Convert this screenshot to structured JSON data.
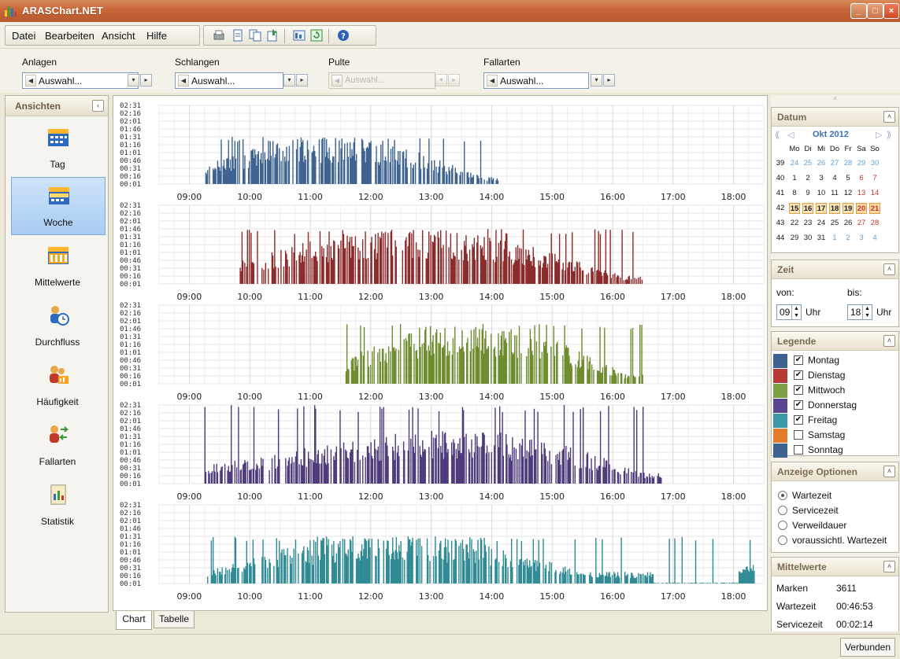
{
  "app": {
    "title": "ARASChart.NET"
  },
  "menu": {
    "items": [
      {
        "label": "Datei"
      },
      {
        "label": "Bearbeiten"
      },
      {
        "label": "Ansicht"
      },
      {
        "label": "Hilfe"
      }
    ]
  },
  "toolbar": {
    "icons": [
      "print-icon",
      "page-icon",
      "copy-icon",
      "export-icon",
      "table-export-icon",
      "refresh-icon",
      "help-icon"
    ]
  },
  "filters": [
    {
      "label": "Anlagen",
      "value": "Auswahl...",
      "disabled": false
    },
    {
      "label": "Schlangen",
      "value": "Auswahl...",
      "disabled": false
    },
    {
      "label": "Pulte",
      "value": "Auswahl...",
      "disabled": true
    },
    {
      "label": "Fallarten",
      "value": "Auswahl...",
      "disabled": false
    }
  ],
  "sidebar": {
    "title": "Ansichten",
    "items": [
      {
        "label": "Tag",
        "icon": "calendar-day-icon",
        "active": false
      },
      {
        "label": "Woche",
        "icon": "calendar-week-icon",
        "active": true
      },
      {
        "label": "Mittelwerte",
        "icon": "calendar-average-icon",
        "active": false
      },
      {
        "label": "Durchfluss",
        "icon": "people-clock-icon",
        "active": false
      },
      {
        "label": "Häufigkeit",
        "icon": "people-chart-icon",
        "active": false
      },
      {
        "label": "Fallarten",
        "icon": "people-arrows-icon",
        "active": false
      },
      {
        "label": "Statistik",
        "icon": "report-icon",
        "active": false
      }
    ]
  },
  "tabs": [
    {
      "label": "Chart",
      "active": true
    },
    {
      "label": "Tabelle",
      "active": false
    }
  ],
  "chart_data": [
    {
      "type": "bar",
      "series": [
        {
          "name": "Montag"
        }
      ],
      "color": "#3d6290",
      "x_range": [
        "08:30",
        "18:30"
      ],
      "x_ticks": [
        "09:00",
        "10:00",
        "11:00",
        "12:00",
        "13:00",
        "14:00",
        "15:00",
        "16:00",
        "17:00",
        "18:00"
      ],
      "y_ticks": [
        "02:31",
        "02:16",
        "02:01",
        "01:46",
        "01:31",
        "01:16",
        "01:01",
        "00:46",
        "00:31",
        "00:16",
        "00:01"
      ],
      "active_range": [
        "09:15",
        "14:07"
      ],
      "peak": "01:31",
      "grid": true
    },
    {
      "type": "bar",
      "series": [
        {
          "name": "Dienstag"
        }
      ],
      "color": "#8b2a2a",
      "x_range": [
        "08:30",
        "18:30"
      ],
      "x_ticks": [
        "09:00",
        "10:00",
        "11:00",
        "12:00",
        "13:00",
        "14:00",
        "15:00",
        "16:00",
        "17:00",
        "18:00"
      ],
      "y_ticks": [
        "02:31",
        "02:16",
        "02:01",
        "01:46",
        "01:31",
        "01:16",
        "01:01",
        "00:46",
        "00:31",
        "00:16",
        "00:01"
      ],
      "active_range": [
        "09:50",
        "16:30"
      ],
      "peak": "01:46",
      "grid": true
    },
    {
      "type": "bar",
      "series": [
        {
          "name": "Mittwoch"
        }
      ],
      "color": "#6d8c2e",
      "x_range": [
        "08:30",
        "18:30"
      ],
      "x_ticks": [
        "09:00",
        "10:00",
        "11:00",
        "12:00",
        "13:00",
        "14:00",
        "15:00",
        "16:00",
        "17:00",
        "18:00"
      ],
      "y_ticks": [
        "02:31",
        "02:16",
        "02:01",
        "01:46",
        "01:31",
        "01:16",
        "01:01",
        "00:46",
        "00:31",
        "00:16",
        "00:01"
      ],
      "active_range": [
        "11:35",
        "16:30"
      ],
      "peak": "01:56",
      "grid": true
    },
    {
      "type": "bar",
      "series": [
        {
          "name": "Donnerstag"
        }
      ],
      "color": "#4e3a7a",
      "x_range": [
        "08:30",
        "18:30"
      ],
      "x_ticks": [
        "09:00",
        "10:00",
        "11:00",
        "12:00",
        "13:00",
        "14:00",
        "15:00",
        "16:00",
        "17:00",
        "18:00"
      ],
      "y_ticks": [
        "02:31",
        "02:16",
        "02:01",
        "01:46",
        "01:31",
        "01:16",
        "01:01",
        "00:46",
        "00:31",
        "00:16",
        "00:01"
      ],
      "active_range": [
        "09:15",
        "16:50"
      ],
      "peak": "02:31",
      "grid": true
    },
    {
      "type": "bar",
      "series": [
        {
          "name": "Freitag"
        }
      ],
      "color": "#2f8a94",
      "x_range": [
        "08:30",
        "18:30"
      ],
      "x_ticks": [
        "09:00",
        "10:00",
        "11:00",
        "12:00",
        "13:00",
        "14:00",
        "15:00",
        "16:00",
        "17:00",
        "18:00"
      ],
      "y_ticks": [
        "02:31",
        "02:16",
        "02:01",
        "01:46",
        "01:31",
        "01:16",
        "01:01",
        "00:46",
        "00:31",
        "00:16",
        "00:01"
      ],
      "active_range": [
        "09:15",
        "18:20"
      ],
      "peak": "01:31",
      "grid": true
    }
  ],
  "datum": {
    "title": "Datum",
    "month": "Okt 2012",
    "weekdays": [
      "Mo",
      "Di",
      "Mi",
      "Do",
      "Fr",
      "Sa",
      "So"
    ],
    "weeks": [
      {
        "wk": "39",
        "days": [
          "24",
          "25",
          "26",
          "27",
          "28",
          "29",
          "30"
        ],
        "other": [
          true,
          true,
          true,
          true,
          true,
          true,
          true
        ]
      },
      {
        "wk": "40",
        "days": [
          "1",
          "2",
          "3",
          "4",
          "5",
          "6",
          "7"
        ],
        "other": [
          false,
          false,
          false,
          false,
          false,
          false,
          false
        ]
      },
      {
        "wk": "41",
        "days": [
          "8",
          "9",
          "10",
          "11",
          "12",
          "13",
          "14"
        ],
        "other": [
          false,
          false,
          false,
          false,
          false,
          false,
          false
        ]
      },
      {
        "wk": "42",
        "days": [
          "15",
          "16",
          "17",
          "18",
          "19",
          "20",
          "21"
        ],
        "other": [
          false,
          false,
          false,
          false,
          false,
          false,
          false
        ]
      },
      {
        "wk": "43",
        "days": [
          "22",
          "23",
          "24",
          "25",
          "26",
          "27",
          "28"
        ],
        "other": [
          false,
          false,
          false,
          false,
          false,
          false,
          false
        ]
      },
      {
        "wk": "44",
        "days": [
          "29",
          "30",
          "31",
          "1",
          "2",
          "3",
          "4"
        ],
        "other": [
          false,
          false,
          false,
          true,
          true,
          true,
          true
        ]
      }
    ]
  },
  "zeit": {
    "title": "Zeit",
    "von_label": "von:",
    "bis_label": "bis:",
    "von_value": "09",
    "bis_value": "18",
    "unit": "Uhr"
  },
  "legende": {
    "title": "Legende",
    "items": [
      {
        "label": "Montag",
        "color": "#3d6290",
        "checked": true
      },
      {
        "label": "Dienstag",
        "color": "#b63a37",
        "checked": true
      },
      {
        "label": "Mittwoch",
        "color": "#7ca044",
        "checked": true
      },
      {
        "label": "Donnerstag",
        "color": "#5b4591",
        "checked": true
      },
      {
        "label": "Freitag",
        "color": "#3b97a6",
        "checked": true
      },
      {
        "label": "Samstag",
        "color": "#e37d2c",
        "checked": false
      },
      {
        "label": "Sonntag",
        "color": "#3d6290",
        "checked": false
      }
    ]
  },
  "optionen": {
    "title": "Anzeige Optionen",
    "items": [
      {
        "label": "Wartezeit",
        "selected": true
      },
      {
        "label": "Servicezeit",
        "selected": false
      },
      {
        "label": "Verweildauer",
        "selected": false
      },
      {
        "label": "voraussichtl. Wartezeit",
        "selected": false
      }
    ]
  },
  "mittelwerte": {
    "title": "Mittelwerte",
    "rows": [
      {
        "label": "Marken",
        "value": "3611"
      },
      {
        "label": "Wartezeit",
        "value": "00:46:53"
      },
      {
        "label": "Servicezeit",
        "value": "00:02:14"
      }
    ]
  },
  "status": {
    "connection": "Verbunden"
  }
}
